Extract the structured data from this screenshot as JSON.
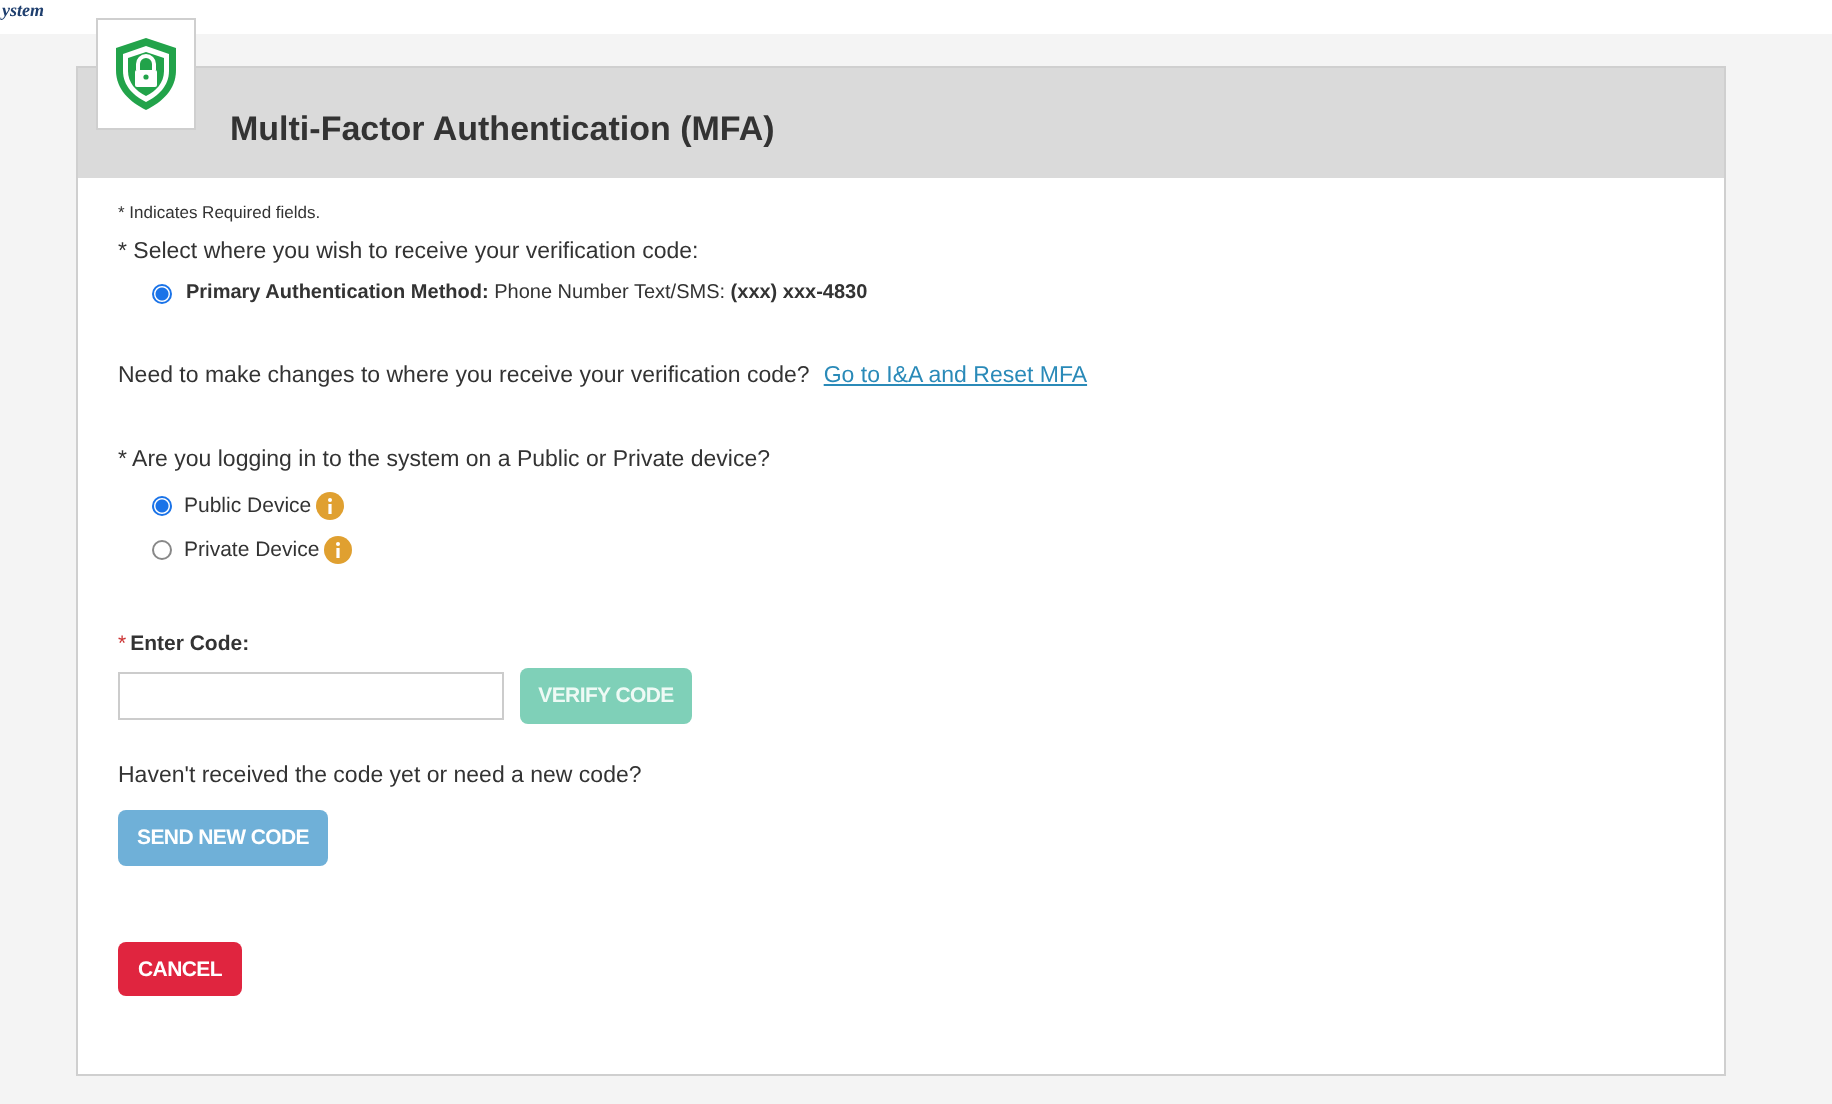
{
  "top_bar": {
    "text": "ystem"
  },
  "header": {
    "title": "Multi-Factor Authentication (MFA)"
  },
  "required_note": "* Indicates Required fields.",
  "method": {
    "question": "* Select where you wish to receive your verification code:",
    "options": [
      {
        "label": "**Primary Authentication Method:** Phone Number Text/SMS: **(xxx) xxx-4830**",
        "selected": true
      }
    ]
  },
  "reset": {
    "text": "Need to make changes to where you receive your verification code?",
    "link": "Go to I&A and Reset MFA"
  },
  "device": {
    "question": "* Are you logging in to the system on a Public or Private device?",
    "options": [
      {
        "label": "Public Device",
        "selected": true
      },
      {
        "label": "Private Device",
        "selected": false
      }
    ]
  },
  "code": {
    "label_mark": "*",
    "label": "Enter Code:",
    "button": {
      "label": "VERIFY CODE",
      "kind": "verify"
    }
  },
  "resend": {
    "text": "Haven't received the code yet or need a new code?",
    "button": {
      "label": "SEND NEW CODE",
      "kind": "send"
    }
  },
  "cancel": {
    "label": "CANCEL",
    "kind": "cancel"
  }
}
